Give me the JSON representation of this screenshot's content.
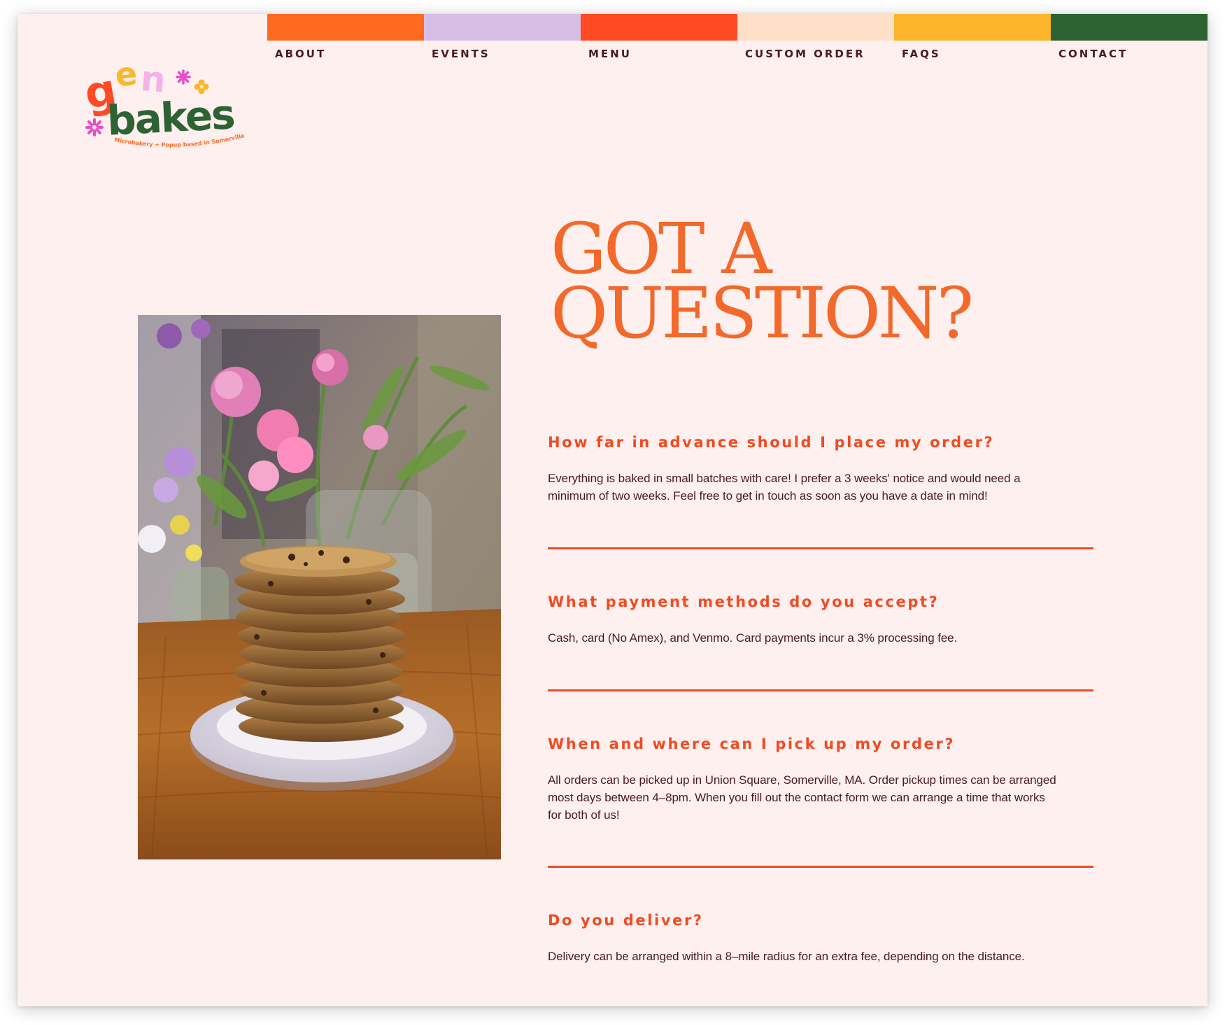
{
  "brand": {
    "logo_word_top": "gen",
    "logo_word_bottom": "bakes",
    "tagline": "Microbakery + Popup based in Somerville, MA"
  },
  "nav": [
    {
      "label": "ABOUT",
      "color": "#ff6a21"
    },
    {
      "label": "EVENTS",
      "color": "#d6bde3"
    },
    {
      "label": "MENU",
      "color": "#ff4a24"
    },
    {
      "label": "CUSTOM ORDER",
      "color": "#ffdfc8"
    },
    {
      "label": "FAQS",
      "color": "#fdb52c"
    },
    {
      "label": "CONTACT",
      "color": "#2d6232"
    }
  ],
  "heading": {
    "line1": "GOT A",
    "line2": "QUESTION?"
  },
  "faqs": [
    {
      "question": "How far in advance should I place my order?",
      "answer_lines": [
        "Everything is baked in small batches with care! I prefer a 3 weeks' notice and would need a",
        "minimum of two weeks. Feel free to get in touch as soon as you have a date in mind!"
      ]
    },
    {
      "question": "What payment methods do you accept?",
      "answer_lines": [
        "Cash, card (No Amex), and Venmo. Card payments incur a 3% processing fee."
      ]
    },
    {
      "question": "When and where can I pick up my order?",
      "answer_lines": [
        "All orders can be picked up in Union Square, Somerville, MA. Order pickup times can be arranged",
        "most days between 4–8pm. When you fill out the contact form we can arrange a time that works",
        "for both of us!"
      ]
    },
    {
      "question": "Do you deliver?",
      "answer_lines": [
        "Delivery can be arranged within a 8–mile radius for an extra fee, depending on the distance."
      ]
    }
  ],
  "colors": {
    "background": "#fdf0ef",
    "accent": "#f04b22",
    "heading": "#f2692b",
    "text": "#4a1a1f"
  }
}
